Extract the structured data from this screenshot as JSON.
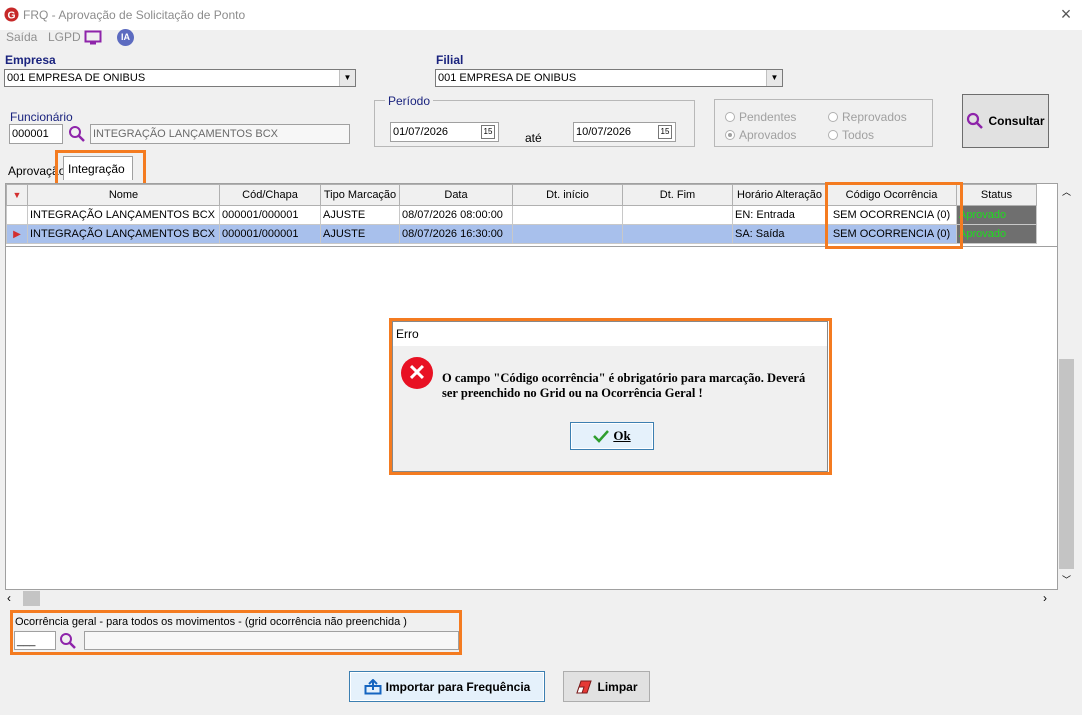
{
  "window": {
    "title": "FRQ - Aprovação de Solicitação de Ponto",
    "close_glyph": "×"
  },
  "menu": {
    "saida": "Saída",
    "lgpd": "LGPD",
    "ia_badge": "IA"
  },
  "empresa": {
    "label": "Empresa",
    "value": "001 EMPRESA DE ONIBUS"
  },
  "filial": {
    "label": "Filial",
    "value": "001 EMPRESA DE ONIBUS"
  },
  "funcionario": {
    "label": "Funcionário",
    "code": "000001",
    "name": "INTEGRAÇÃO LANÇAMENTOS BCX"
  },
  "periodo": {
    "label": "Período",
    "start": "01/07/2026",
    "end": "10/07/2026",
    "ate": "até",
    "cal_glyph": "15"
  },
  "filters": {
    "pendentes": "Pendentes",
    "reprovados": "Reprovados",
    "aprovados": "Aprovados",
    "todos": "Todos",
    "selected": "Aprovados"
  },
  "consultar_label": "Consultar",
  "tabs": {
    "aprovacao": "Aprovação",
    "integracao": "Integração",
    "active": "Integração"
  },
  "grid": {
    "columns": [
      "Nome",
      "Cód/Chapa",
      "Tipo Marcação",
      "Data",
      "Dt. início",
      "Dt. Fim",
      "Horário Alteração",
      "Código Ocorrência",
      "Status"
    ],
    "rows": [
      {
        "nome": "INTEGRAÇÃO LANÇAMENTOS BCX",
        "cod": "000001/000001",
        "tipo": "AJUSTE",
        "data": "08/07/2026 08:00:00",
        "dt_inicio": "",
        "dt_fim": "",
        "horario": "EN: Entrada",
        "codigo": "SEM OCORRENCIA (0)",
        "status": "Aprovado"
      },
      {
        "nome": "INTEGRAÇÃO LANÇAMENTOS BCX",
        "cod": "000001/000001",
        "tipo": "AJUSTE",
        "data": "08/07/2026 16:30:00",
        "dt_inicio": "",
        "dt_fim": "",
        "horario": "SA: Saída",
        "codigo": "SEM OCORRENCIA (0)",
        "status": "Aprovado"
      }
    ],
    "selected_row": 1,
    "status_color": "#1fdd1f"
  },
  "dialog": {
    "title": "Erro",
    "message": "O campo \"Código ocorrência\" é obrigatório para marcação. Deverá ser preenchido no Grid ou na Ocorrência Geral !",
    "ok_label": "Ok",
    "icon": "error-x-icon"
  },
  "ocorrencia_geral": {
    "label": "Ocorrência geral - para todos os movimentos - (grid ocorrência  não preenchida )",
    "code": "___",
    "desc": ""
  },
  "buttons": {
    "importar": "Importar para Frequência",
    "limpar": "Limpar"
  },
  "colors": {
    "highlight": "#f47b20",
    "accent": "#1a237e",
    "selected_row": "#a8c0ec",
    "error_red": "#e81123",
    "icon_purple": "#8e24aa"
  }
}
